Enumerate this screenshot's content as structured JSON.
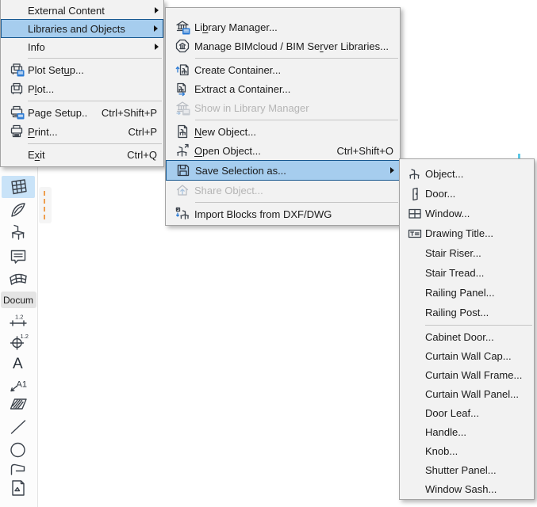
{
  "colors": {
    "menu_bg": "#f2f2f2",
    "menu_border": "#a3a3a3",
    "highlight_fill": "#a6cdee",
    "highlight_border": "#16578f",
    "text": "#1a1a1a",
    "disabled_text": "#b5b5b5",
    "icon_stroke": "#3b424b",
    "icon_accent": "#2e7cd4",
    "toolbar_selected_bg": "#c9e3f8",
    "guide_orange": "#ef9e4d"
  },
  "file_menu": {
    "items": [
      {
        "id": "external-content",
        "label": "External Content",
        "submenu": true
      },
      {
        "id": "libraries-and-objects",
        "label": "Libraries and Objects",
        "submenu": true,
        "highlighted": true
      },
      {
        "id": "info",
        "label": "Info",
        "submenu": true
      },
      {
        "id": "plot-setup",
        "label": "Plot Setup...",
        "accel": "u",
        "icon": "plot-setup-icon"
      },
      {
        "id": "plot",
        "label": "Plot...",
        "accel": "l",
        "icon": "plot-icon"
      },
      {
        "id": "page-setup",
        "label": "Page Setup...",
        "accel": "g",
        "shortcut": "Ctrl+Shift+P",
        "icon": "page-setup-icon"
      },
      {
        "id": "print",
        "label": "Print...",
        "accel": "P",
        "shortcut": "Ctrl+P",
        "icon": "print-icon"
      },
      {
        "id": "exit",
        "label": "Exit",
        "accel": "x",
        "shortcut": "Ctrl+Q"
      }
    ]
  },
  "libraries_menu": {
    "items": [
      {
        "id": "library-manager",
        "label": "Library Manager...",
        "accel": "b",
        "icon": "library-manager-icon"
      },
      {
        "id": "manage-bimcloud",
        "label": "Manage BIMcloud / BIM Server Libraries...",
        "accel": "r",
        "icon": "bimcloud-icon"
      },
      {
        "id": "create-container",
        "label": "Create Container...",
        "icon": "create-container-icon"
      },
      {
        "id": "extract-container",
        "label": "Extract a Container...",
        "icon": "extract-container-icon"
      },
      {
        "id": "show-in-library-manager",
        "label": "Show in Library Manager",
        "icon": "show-in-library-manager-icon",
        "disabled": true
      },
      {
        "id": "new-object",
        "label": "New Object...",
        "accel": "N",
        "icon": "new-object-icon"
      },
      {
        "id": "open-object",
        "label": "Open Object...",
        "accel": "O",
        "shortcut": "Ctrl+Shift+O",
        "icon": "open-object-icon"
      },
      {
        "id": "save-selection-as",
        "label": "Save Selection as...",
        "icon": "save-icon",
        "highlighted": true,
        "submenu": true
      },
      {
        "id": "share-object",
        "label": "Share Object...",
        "icon": "share-object-icon",
        "disabled": true
      },
      {
        "id": "import-blocks",
        "label": "Import Blocks from DXF/DWG",
        "icon": "import-blocks-icon"
      }
    ]
  },
  "save_selection_menu": {
    "items": [
      {
        "id": "object",
        "label": "Object...",
        "icon": "object-icon"
      },
      {
        "id": "door",
        "label": "Door...",
        "icon": "door-icon"
      },
      {
        "id": "window",
        "label": "Window...",
        "icon": "window-icon"
      },
      {
        "id": "drawing-title",
        "label": "Drawing Title...",
        "icon": "drawing-title-icon"
      },
      {
        "id": "stair-riser",
        "label": "Stair Riser..."
      },
      {
        "id": "stair-tread",
        "label": "Stair Tread..."
      },
      {
        "id": "railing-panel",
        "label": "Railing Panel..."
      },
      {
        "id": "railing-post",
        "label": "Railing Post..."
      },
      {
        "id": "cabinet-door",
        "label": "Cabinet Door..."
      },
      {
        "id": "curtain-wall-cap",
        "label": "Curtain Wall Cap..."
      },
      {
        "id": "curtain-wall-frame",
        "label": "Curtain Wall Frame..."
      },
      {
        "id": "curtain-wall-panel",
        "label": "Curtain Wall Panel..."
      },
      {
        "id": "door-leaf",
        "label": "Door Leaf..."
      },
      {
        "id": "handle",
        "label": "Handle..."
      },
      {
        "id": "knob",
        "label": "Knob..."
      },
      {
        "id": "shutter-panel",
        "label": "Shutter Panel..."
      },
      {
        "id": "window-sash",
        "label": "Window Sash..."
      }
    ]
  },
  "toolbar": {
    "group_label": "Docum",
    "selected_tool": "curtain-wall",
    "tools": [
      "roof-icon",
      "curtain-wall-icon",
      "shell-icon",
      "object-tool-icon",
      "zone-icon",
      "mesh-icon",
      "dimension-icon",
      "level-dimension-icon",
      "text-icon",
      "label-icon",
      "fill-icon",
      "line-icon",
      "circle-icon",
      "polyline-icon",
      "figure-icon"
    ]
  }
}
